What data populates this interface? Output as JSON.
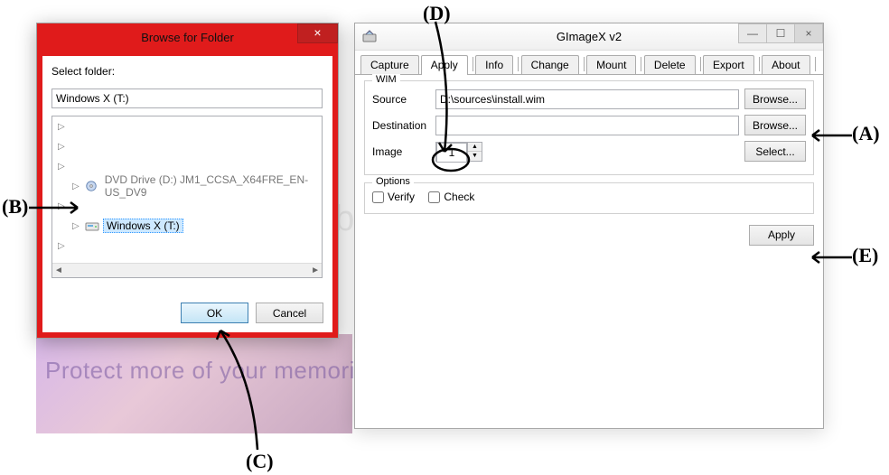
{
  "browse": {
    "title": "Browse for Folder",
    "instr": "Select folder:",
    "combo": "Windows X (T:)",
    "tree": {
      "dvd": "DVD Drive (D:) JM1_CCSA_X64FRE_EN-US_DV9",
      "winx": "Windows X (T:)"
    },
    "ok": "OK",
    "cancel": "Cancel"
  },
  "app": {
    "title": "GImageX v2",
    "tabs": {
      "capture": "Capture",
      "apply": "Apply",
      "info": "Info",
      "change": "Change",
      "mount": "Mount",
      "delete": "Delete",
      "export": "Export",
      "about": "About"
    },
    "wim": {
      "legend": "WIM",
      "source_label": "Source",
      "source_value": "D:\\sources\\install.wim",
      "dest_label": "Destination",
      "dest_value": "",
      "image_label": "Image",
      "image_value": "1",
      "browse": "Browse...",
      "select": "Select..."
    },
    "options": {
      "legend": "Options",
      "verify": "Verify",
      "check": "Check"
    },
    "apply_btn": "Apply"
  },
  "watermark": "Protect more of your memories for less!",
  "logo": "photobucket",
  "annot": {
    "a": "(A)",
    "b": "(B)",
    "c": "(C)",
    "d": "(D)",
    "e": "(E)"
  }
}
